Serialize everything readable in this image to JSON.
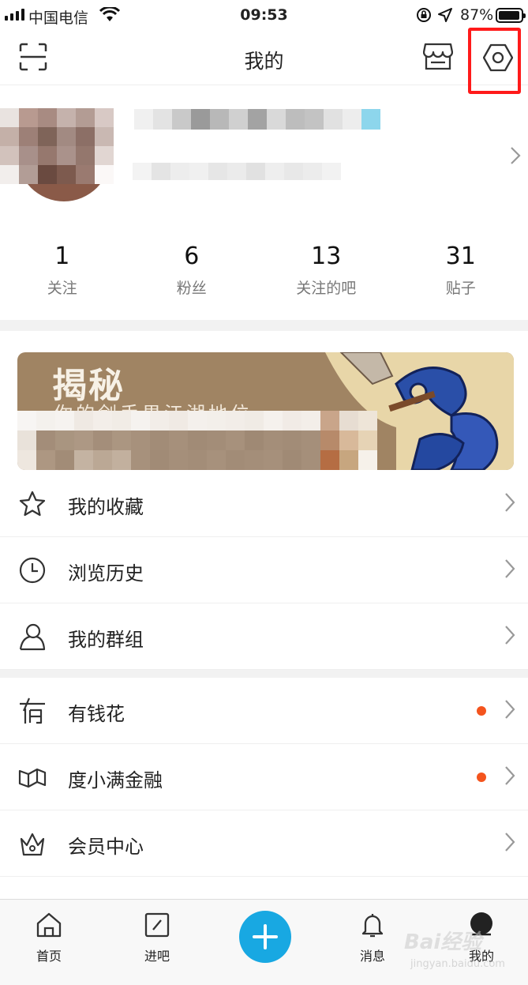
{
  "status_bar": {
    "carrier": "中国电信",
    "time": "09:53",
    "battery_percent": "87%"
  },
  "header": {
    "title": "我的"
  },
  "profile": {
    "name_blurred": true,
    "chevron": "›"
  },
  "stats": [
    {
      "count": "1",
      "label": "关注"
    },
    {
      "count": "6",
      "label": "粉丝"
    },
    {
      "count": "13",
      "label": "关注的吧"
    },
    {
      "count": "31",
      "label": "贴子"
    }
  ],
  "banner": {
    "title": "揭秘",
    "subtitle": "你的剑手男江湖地位"
  },
  "menu": [
    {
      "label": "我的收藏",
      "icon": "star-icon",
      "dot": false
    },
    {
      "label": "浏览历史",
      "icon": "clock-icon",
      "dot": false
    },
    {
      "label": "我的群组",
      "icon": "group-icon",
      "dot": false
    },
    {
      "label": "有钱花",
      "icon": "money-icon",
      "dot": true
    },
    {
      "label": "度小满金融",
      "icon": "finance-icon",
      "dot": true
    },
    {
      "label": "会员中心",
      "icon": "crown-icon",
      "dot": false
    }
  ],
  "tabbar": {
    "tabs": [
      {
        "label": "首页",
        "icon": "home-icon"
      },
      {
        "label": "进吧",
        "icon": "enter-bar-icon"
      },
      {
        "label": "消息",
        "icon": "bell-icon"
      },
      {
        "label": "我的",
        "icon": "profile-icon"
      }
    ]
  },
  "watermark": "Bai经验",
  "watermark_url": "jingyan.baidu.com",
  "colors": {
    "accent": "#18a8e2",
    "notification_dot": "#f4541d",
    "highlight_box": "#ff1a1a"
  }
}
